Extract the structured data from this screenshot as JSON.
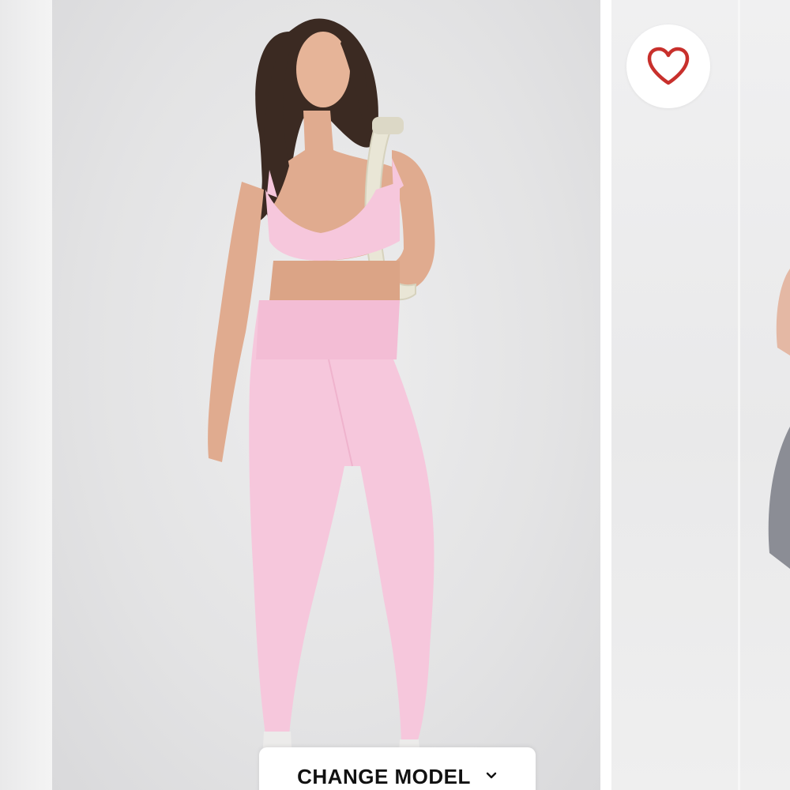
{
  "gallery": {
    "change_model_label": "CHANGE MODEL",
    "favorite_icon": "heart-icon",
    "dropdown_icon": "chevron-down-icon"
  },
  "colors": {
    "heart": "#c8302c",
    "outfit": "#f6c7dc",
    "background": "#e4e4e5"
  }
}
